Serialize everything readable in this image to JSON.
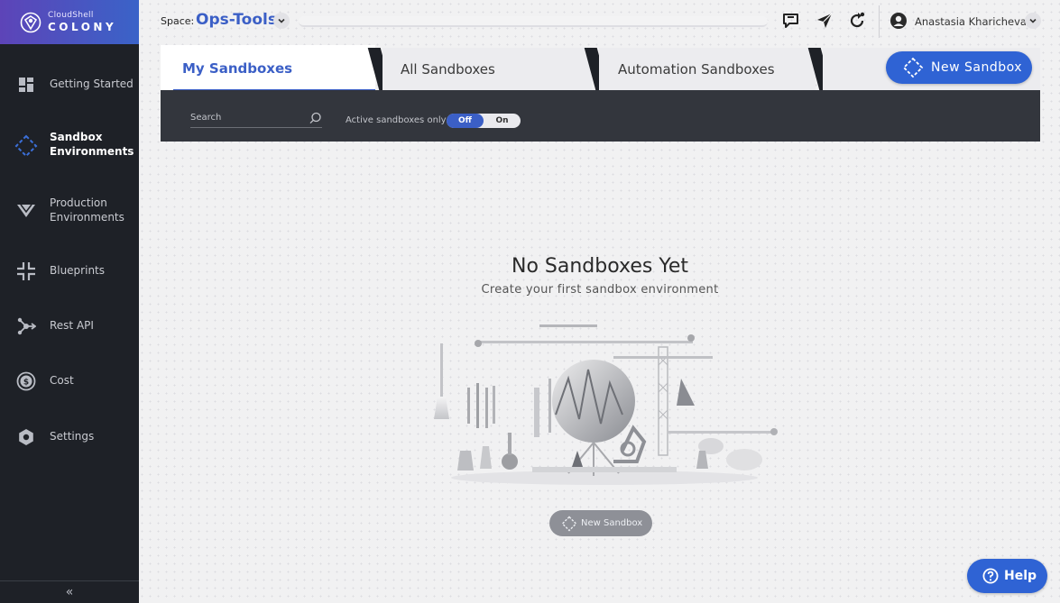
{
  "brand": {
    "sub": "CloudShell",
    "name": "COLONY"
  },
  "sidebar": {
    "items": [
      {
        "label": "Getting Started",
        "icon": "dashboard-icon"
      },
      {
        "label": "Sandbox Environments",
        "icon": "sandbox-diamond-icon",
        "active": true
      },
      {
        "label": "Production Environments",
        "icon": "production-icon"
      },
      {
        "label": "Blueprints",
        "icon": "blueprints-icon"
      },
      {
        "label": "Rest API",
        "icon": "rest-api-icon"
      },
      {
        "label": "Cost",
        "icon": "cost-dollar-icon"
      },
      {
        "label": "Settings",
        "icon": "settings-icon"
      }
    ],
    "collapse": "«"
  },
  "header": {
    "space_label": "Space:",
    "space_name": "Ops-Tools",
    "user_name": "Anastasia Kharicheva",
    "icons": [
      "announcement-icon",
      "send-icon",
      "refresh-icon",
      "user-avatar-icon"
    ]
  },
  "tabs": [
    {
      "label": "My Sandboxes",
      "active": true
    },
    {
      "label": "All Sandboxes"
    },
    {
      "label": "Automation Sandboxes"
    }
  ],
  "new_sandbox_button": "New Sandbox",
  "toolbar": {
    "search_placeholder": "Search",
    "active_label": "Active sandboxes only",
    "toggle_off": "Off",
    "toggle_on": "On",
    "toggle_selected": "Off"
  },
  "empty_state": {
    "title": "No Sandboxes Yet",
    "subtitle": "Create your first sandbox environment",
    "button": "New Sandbox"
  },
  "help": "Help",
  "colors": {
    "accent": "#3b5fc6",
    "button_blue": "#2f63d4",
    "sidebar_bg": "#1e2127",
    "toolbar_bg": "#33363d"
  }
}
